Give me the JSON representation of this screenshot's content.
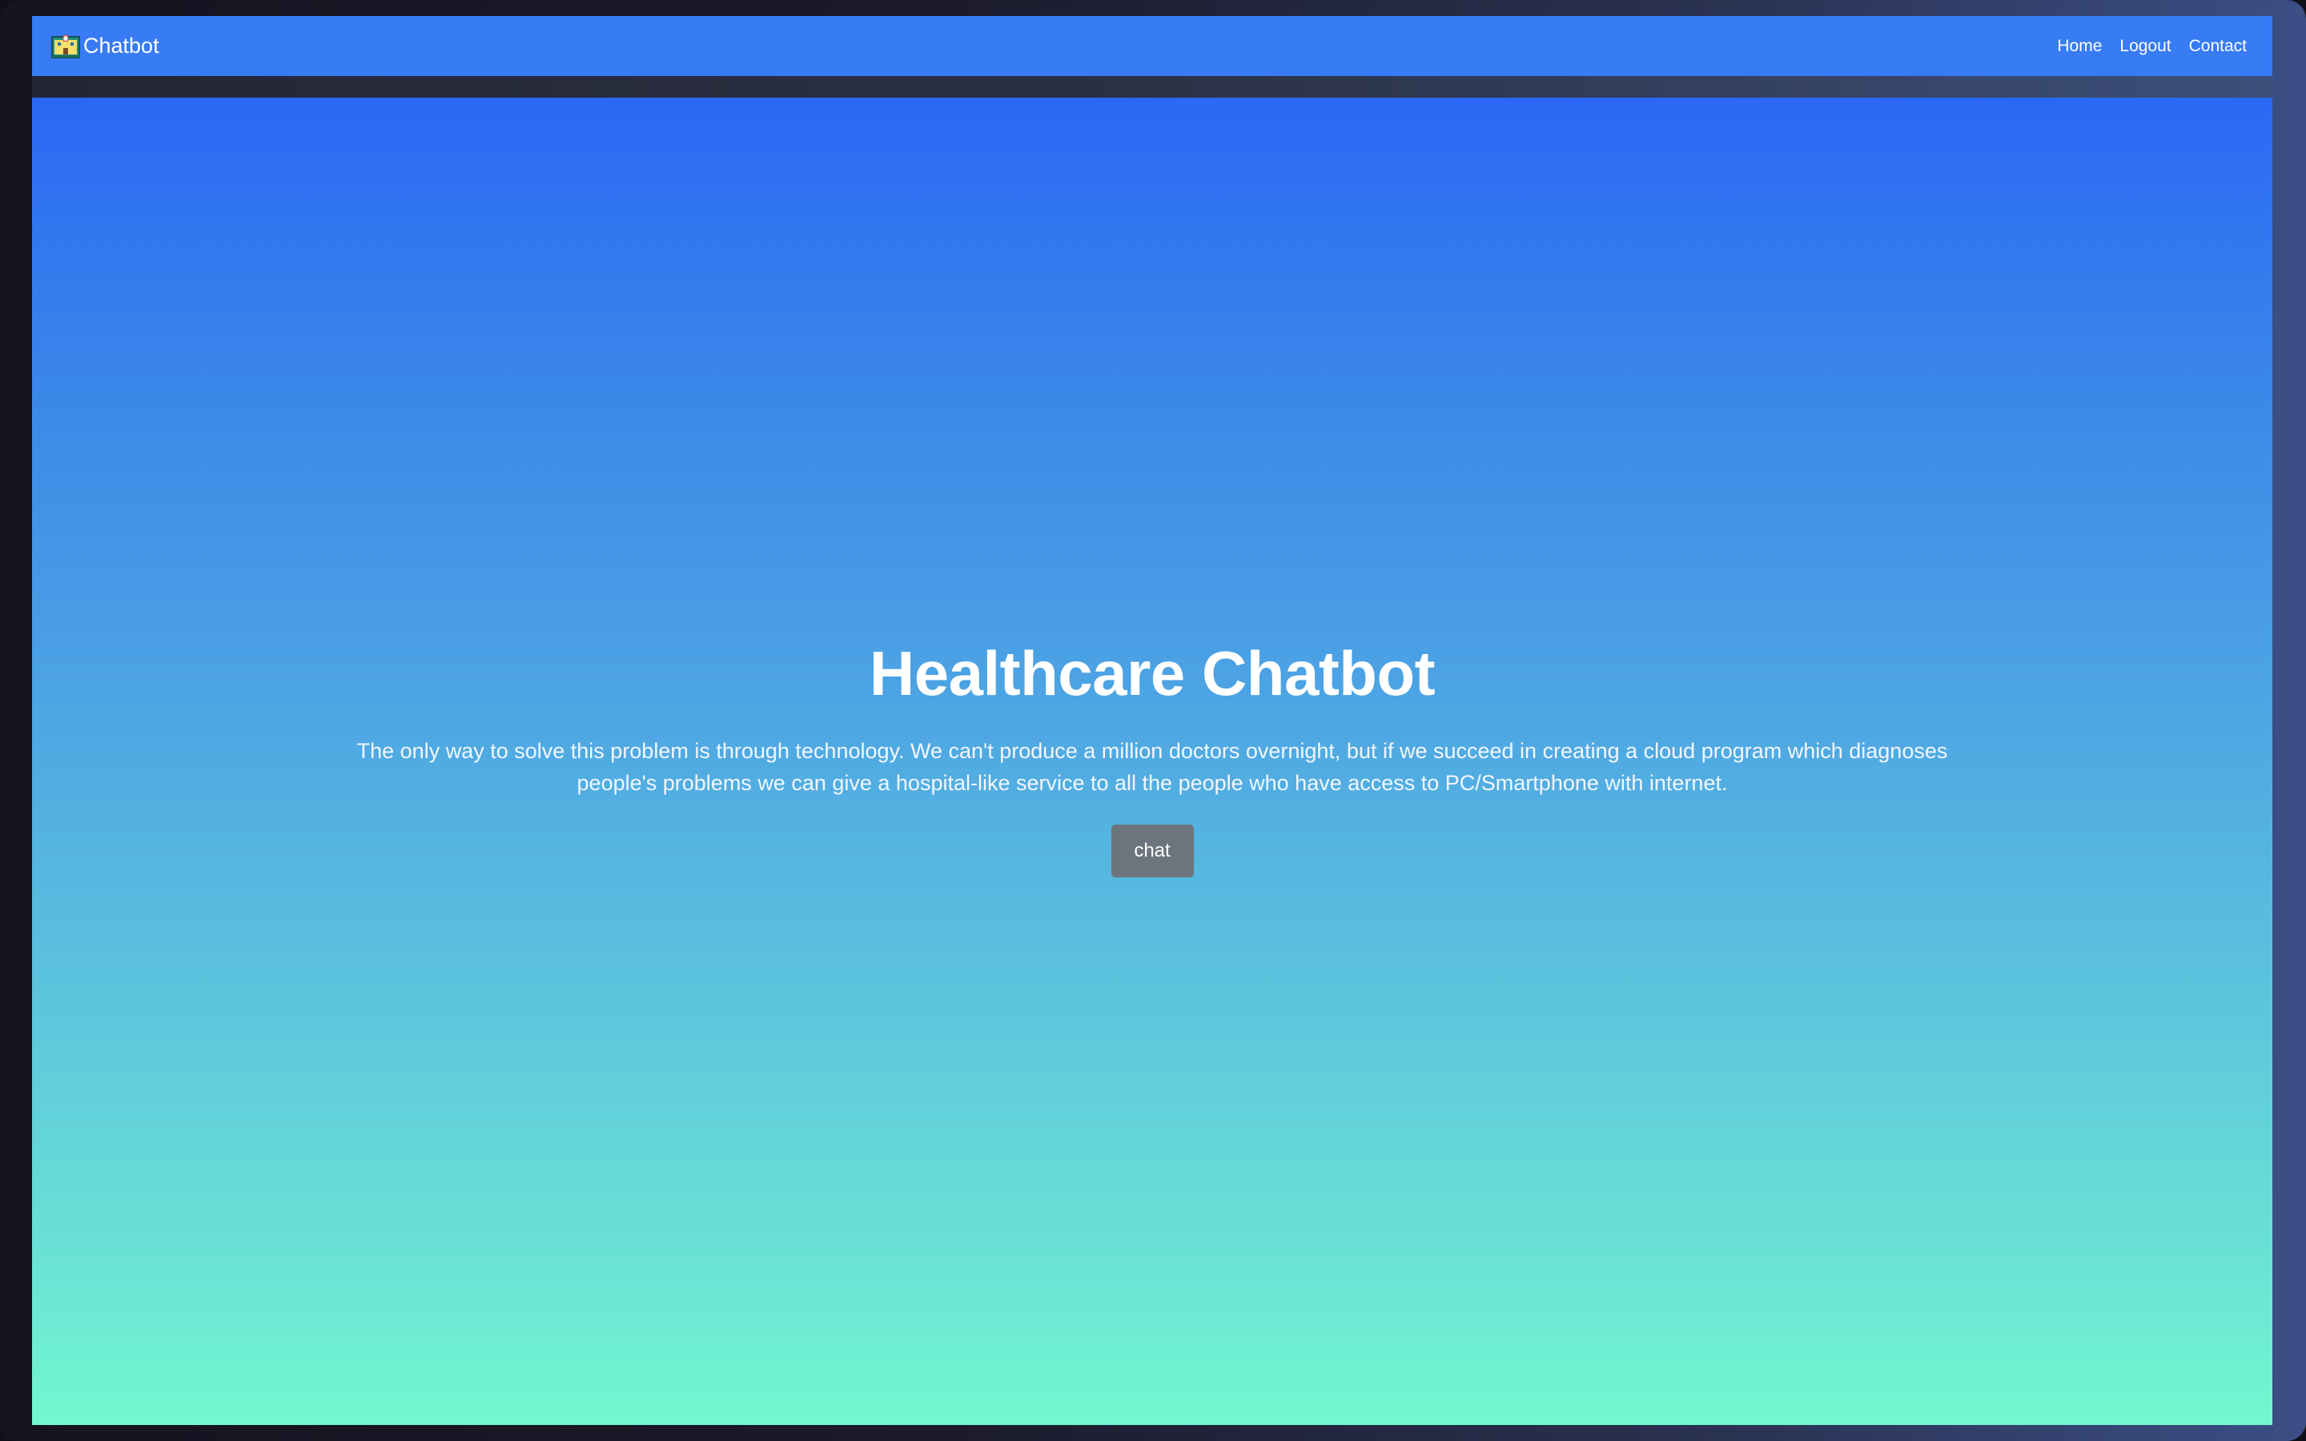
{
  "navbar": {
    "brand_label": "Chatbot",
    "brand_icon": "hospital-icon",
    "links": [
      {
        "label": "Home"
      },
      {
        "label": "Logout"
      },
      {
        "label": "Contact"
      }
    ],
    "background_color": "#377bf5"
  },
  "hero": {
    "title": "Healthcare Chatbot",
    "description": "The only way to solve this problem is through technology. We can't produce a million doctors overnight, but if we succeed in creating a cloud program which diagnoses people's problems we can give a hospital-like service to all the people who have access to PC/Smartphone with internet.",
    "button_label": "chat",
    "gradient_top_color": "#2b68f5",
    "gradient_bottom_color": "#72f8cf",
    "button_color": "#6c757d"
  }
}
